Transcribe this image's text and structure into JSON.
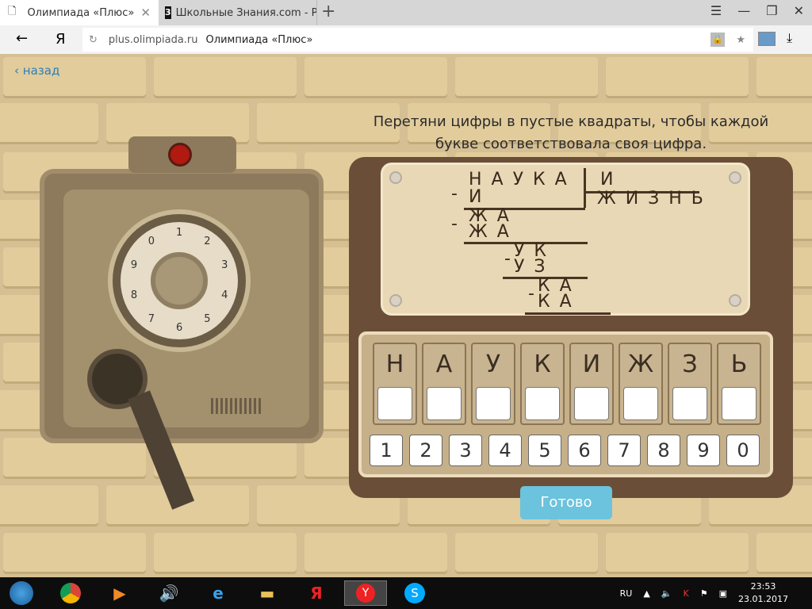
{
  "browser": {
    "tabs": [
      {
        "title": "Олимпиада «Плюс»",
        "active": true
      },
      {
        "title": "Школьные Знания.com - Ре",
        "active": false
      }
    ],
    "url_domain": "plus.olimpiada.ru",
    "page_title": "Олимпиада «Плюс»",
    "yandex": "Я"
  },
  "page": {
    "back_label": "назад",
    "instruction": "Перетяни цифры в пустые квадраты, чтобы каждой букве соответствовала своя цифра.",
    "division": {
      "dividend": "НАУКА",
      "divisor": "И",
      "quotient": "ЖИЗНЬ",
      "steps": [
        [
          "И"
        ],
        [
          "ЖА",
          "ЖА"
        ],
        [
          "УК",
          "УЗ"
        ],
        [
          "КА",
          "КА"
        ]
      ]
    },
    "letters": [
      "Н",
      "А",
      "У",
      "К",
      "И",
      "Ж",
      "З",
      "Ь"
    ],
    "digits": [
      "1",
      "2",
      "3",
      "4",
      "5",
      "6",
      "7",
      "8",
      "9",
      "0"
    ],
    "submit_label": "Готово",
    "dial_digits": [
      "0",
      "1",
      "2",
      "3",
      "4",
      "5",
      "6",
      "7",
      "8",
      "9"
    ]
  },
  "taskbar": {
    "lang": "RU",
    "time": "23:53",
    "date": "23.01.2017"
  },
  "colors": {
    "submit": "#6cc3dd",
    "link": "#2c7fb8"
  }
}
